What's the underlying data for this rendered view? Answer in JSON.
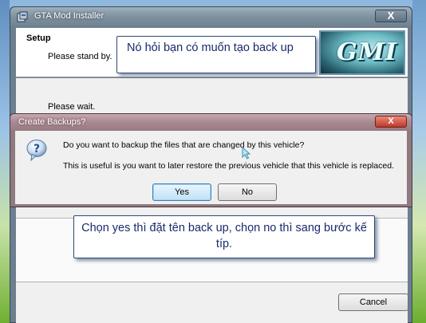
{
  "window": {
    "title": "GTA Mod Installer",
    "close_glyph": "X",
    "header": {
      "title": "Setup",
      "subtitle": "Please stand by."
    },
    "logo_text": "GMI",
    "body_text": "Please wait.",
    "cancel_label": "Cancel"
  },
  "dialog": {
    "title": "Create Backups?",
    "close_glyph": "X",
    "icon": "question-icon",
    "line1": "Do you want to backup the files that are changed by this vehicle?",
    "line2": "This is useful is you want to later restore the previous vehicle that this vehicle is replaced.",
    "yes_label": "Yes",
    "no_label": "No"
  },
  "annotations": {
    "top": "Nó hỏi bạn có muốn tạo back up",
    "bottom": "Chọn yes thì đặt tên back up, chọn no thì sang bước kế típ."
  }
}
